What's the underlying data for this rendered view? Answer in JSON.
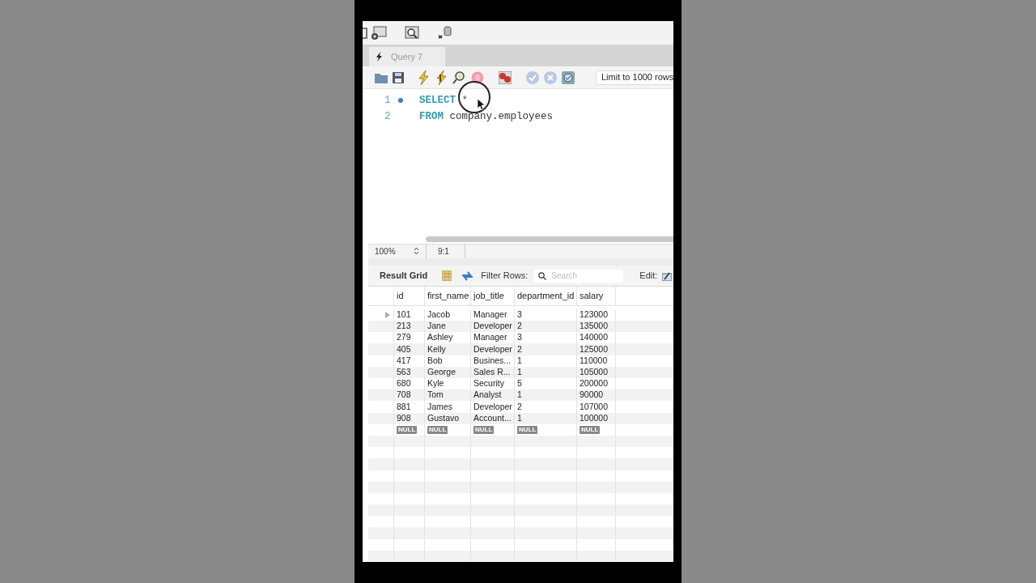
{
  "query_tab": {
    "label": "Query 7",
    "selected": true
  },
  "limit_select": {
    "value": "Limit to 1000 rows"
  },
  "editor": {
    "lines": [
      {
        "number": "1",
        "marker": true,
        "tokens": [
          {
            "kind": "keyword",
            "text": "SELECT"
          },
          {
            "kind": "plain",
            "text": "*"
          }
        ]
      },
      {
        "number": "2",
        "marker": false,
        "tokens": [
          {
            "kind": "keyword",
            "text": "FROM"
          },
          {
            "kind": "plain",
            "text": "company.employees"
          }
        ]
      }
    ]
  },
  "status_bar": {
    "zoom": "100%",
    "position": "9:1"
  },
  "results": {
    "title": "Result Grid",
    "filter_label": "Filter Rows:",
    "search_placeholder": "Search",
    "edit_label": "Edit:",
    "columns": [
      "id",
      "first_name",
      "job_title",
      "department_id",
      "salary"
    ],
    "rows": [
      {
        "current": true,
        "cells": [
          "101",
          "Jacob",
          "Manager",
          "3",
          "123000"
        ]
      },
      {
        "current": false,
        "cells": [
          "213",
          "Jane",
          "Developer",
          "2",
          "135000"
        ]
      },
      {
        "current": false,
        "cells": [
          "279",
          "Ashley",
          "Manager",
          "3",
          "140000"
        ]
      },
      {
        "current": false,
        "cells": [
          "405",
          "Kelly",
          "Developer",
          "2",
          "125000"
        ]
      },
      {
        "current": false,
        "cells": [
          "417",
          "Bob",
          "Busines...",
          "1",
          "110000"
        ]
      },
      {
        "current": false,
        "cells": [
          "563",
          "George",
          "Sales R...",
          "1",
          "105000"
        ]
      },
      {
        "current": false,
        "cells": [
          "680",
          "Kyle",
          "Security",
          "5",
          "200000"
        ]
      },
      {
        "current": false,
        "cells": [
          "708",
          "Tom",
          "Analyst",
          "1",
          "90000"
        ]
      },
      {
        "current": false,
        "cells": [
          "881",
          "James",
          "Developer",
          "2",
          "107000"
        ]
      },
      {
        "current": false,
        "cells": [
          "908",
          "Gustavo",
          "Account...",
          "1",
          "100000"
        ]
      }
    ],
    "new_row": [
      "NULL",
      "NULL",
      "NULL",
      "NULL",
      "NULL"
    ]
  }
}
